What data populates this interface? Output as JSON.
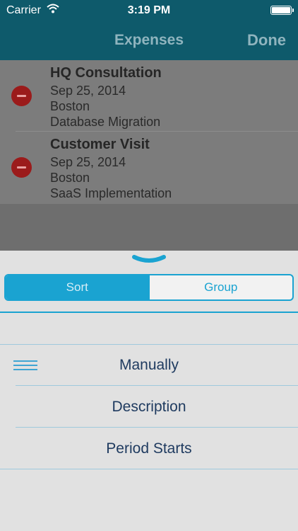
{
  "status_bar": {
    "carrier": "Carrier",
    "time": "3:19 PM"
  },
  "nav": {
    "title": "Expenses",
    "done_label": "Done"
  },
  "expenses": [
    {
      "title": "HQ Consultation",
      "date": "Sep 25, 2014",
      "location": "Boston",
      "project": "Database Migration"
    },
    {
      "title": "Customer Visit",
      "date": "Sep 25, 2014",
      "location": "Boston",
      "project": "SaaS Implementation"
    }
  ],
  "sheet": {
    "segments": {
      "sort_label": "Sort",
      "group_label": "Group"
    },
    "options": [
      "Manually",
      "Description",
      "Period Starts"
    ]
  },
  "colors": {
    "nav_bg": "#0e5a6b",
    "accent": "#1aa3d1",
    "delete": "#9b1b1b"
  },
  "icons": [
    "wifi-icon",
    "battery-icon",
    "delete-icon",
    "chevron-down-icon",
    "reorder-icon"
  ]
}
